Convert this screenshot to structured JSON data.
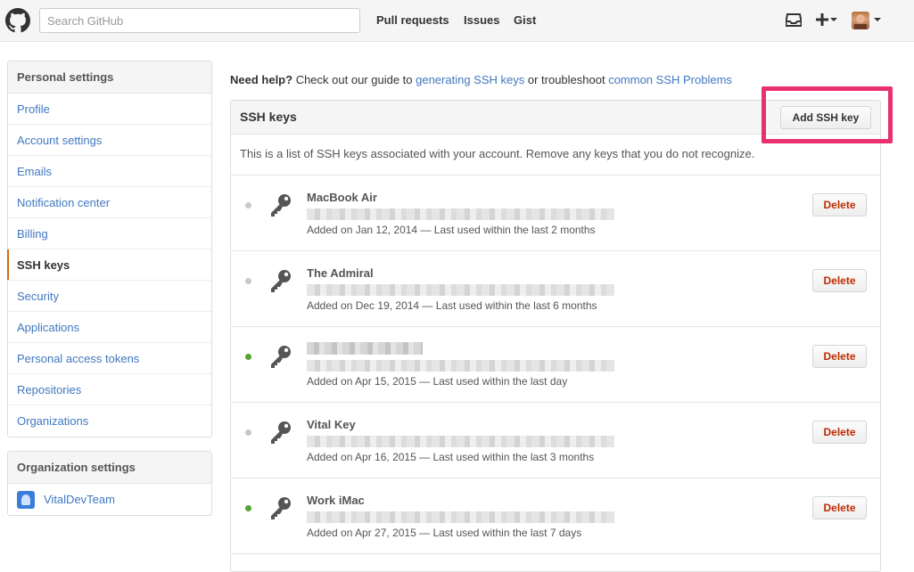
{
  "header": {
    "search_placeholder": "Search GitHub",
    "nav": [
      "Pull requests",
      "Issues",
      "Gist"
    ],
    "icons": [
      "octocat-logo-icon",
      "inbox-icon",
      "plus-icon",
      "avatar"
    ]
  },
  "sidebar": {
    "personal_heading": "Personal settings",
    "items": [
      {
        "label": "Profile",
        "selected": false
      },
      {
        "label": "Account settings",
        "selected": false
      },
      {
        "label": "Emails",
        "selected": false
      },
      {
        "label": "Notification center",
        "selected": false
      },
      {
        "label": "Billing",
        "selected": false
      },
      {
        "label": "SSH keys",
        "selected": true
      },
      {
        "label": "Security",
        "selected": false
      },
      {
        "label": "Applications",
        "selected": false
      },
      {
        "label": "Personal access tokens",
        "selected": false
      },
      {
        "label": "Repositories",
        "selected": false
      },
      {
        "label": "Organizations",
        "selected": false
      }
    ],
    "org_heading": "Organization settings",
    "org_name": "VitalDevTeam"
  },
  "help": {
    "lead": "Need help?",
    "text1": " Check out our guide to ",
    "link1": "generating SSH keys",
    "text2": " or troubleshoot ",
    "link2": "common SSH Problems"
  },
  "panel": {
    "title": "SSH keys",
    "add_button": "Add SSH key",
    "description": "This is a list of SSH keys associated with your account. Remove any keys that you do not recognize."
  },
  "keys": [
    {
      "title": "MacBook Air",
      "meta": "Added on Jan 12, 2014 — Last used within the last 2 months",
      "active": false
    },
    {
      "title": "The Admiral",
      "meta": "Added on Dec 19, 2014 — Last used within the last 6 months",
      "active": false
    },
    {
      "title": "",
      "meta": "Added on Apr 15, 2015 — Last used within the last day",
      "active": true
    },
    {
      "title": "Vital Key",
      "meta": "Added on Apr 16, 2015 — Last used within the last 3 months",
      "active": false
    },
    {
      "title": "Work iMac",
      "meta": "Added on Apr 27, 2015 — Last used within the last 7 days",
      "active": true
    }
  ],
  "delete_label": "Delete",
  "colors": {
    "link": "#4078c0",
    "active_dot": "#55a532",
    "danger": "#bd2c00",
    "highlight": "#e8316f",
    "selected_bar": "#d26911"
  }
}
